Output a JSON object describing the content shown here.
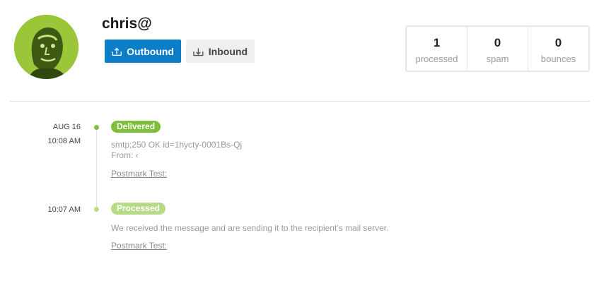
{
  "profile": {
    "username": "chris@",
    "avatar_alt": "user avatar"
  },
  "tabs": {
    "outbound_label": "Outbound",
    "inbound_label": "Inbound"
  },
  "stats": [
    {
      "value": "1",
      "label": "processed"
    },
    {
      "value": "0",
      "label": "spam"
    },
    {
      "value": "0",
      "label": "bounces"
    }
  ],
  "timeline": [
    {
      "date": "AUG 16",
      "time": "10:08 AM",
      "status": "Delivered",
      "status_color": "#7fbf3a",
      "detail_line1": "smtp;250 OK id=1hycty-0001Bs-Qj",
      "detail_line2": "From: ‹",
      "link": "Postmark Test:"
    },
    {
      "date": "",
      "time": "10:07 AM",
      "status": "Processed",
      "status_color": "#b7da86",
      "detail_line1": "We received the message and are sending it to the recipient’s mail server.",
      "link": "Postmark Test:"
    }
  ],
  "colors": {
    "primary": "#0b7ec7",
    "delivered": "#7fbf3a",
    "processed": "#b7da86"
  }
}
